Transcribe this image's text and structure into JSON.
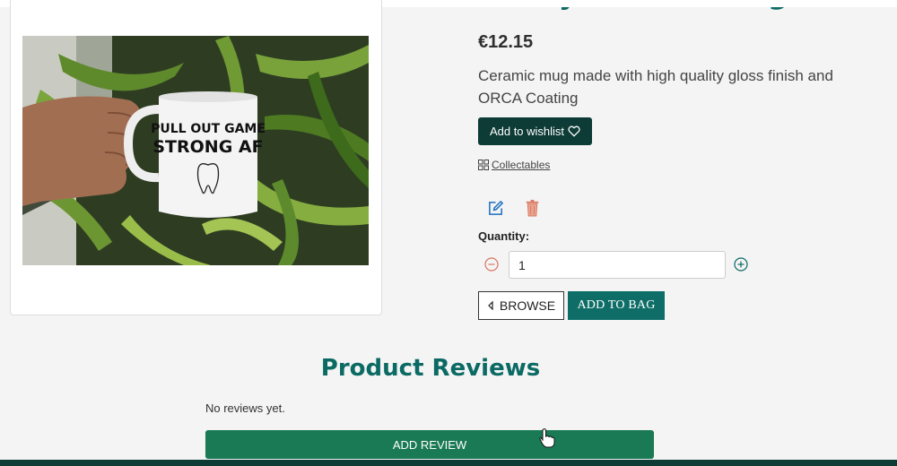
{
  "product": {
    "title": "Funny Dentist Mug",
    "price": "€12.15",
    "description": "Ceramic mug made with high quality gloss finish and ORCA Coating",
    "mug_text_line1": "PULL OUT GAME",
    "mug_text_line2": "STRONG AF"
  },
  "actions": {
    "wishlist_label": "Add to wishlist",
    "collectables_label": "Collectables",
    "quantity_label": "Quantity:",
    "quantity_value": "1",
    "browse_label": "BROWSE",
    "add_to_bag_label": "ADD TO BAG"
  },
  "reviews": {
    "heading": "Product Reviews",
    "empty_text": "No reviews yet.",
    "add_review_label": "ADD REVIEW"
  },
  "icons": {
    "wishlist": "heart-icon",
    "collectables": "grid-icon",
    "edit": "pencil-square-icon",
    "delete": "trash-icon",
    "decrease": "minus-circle-icon",
    "increase": "plus-circle-icon",
    "browse": "chevron-left-icon",
    "cursor": "hand-pointer-icon"
  },
  "colors": {
    "brand_teal": "#0b6a63",
    "dark_green": "#0d3b36",
    "review_green": "#1a7a55",
    "delete_red": "#d9775f"
  }
}
